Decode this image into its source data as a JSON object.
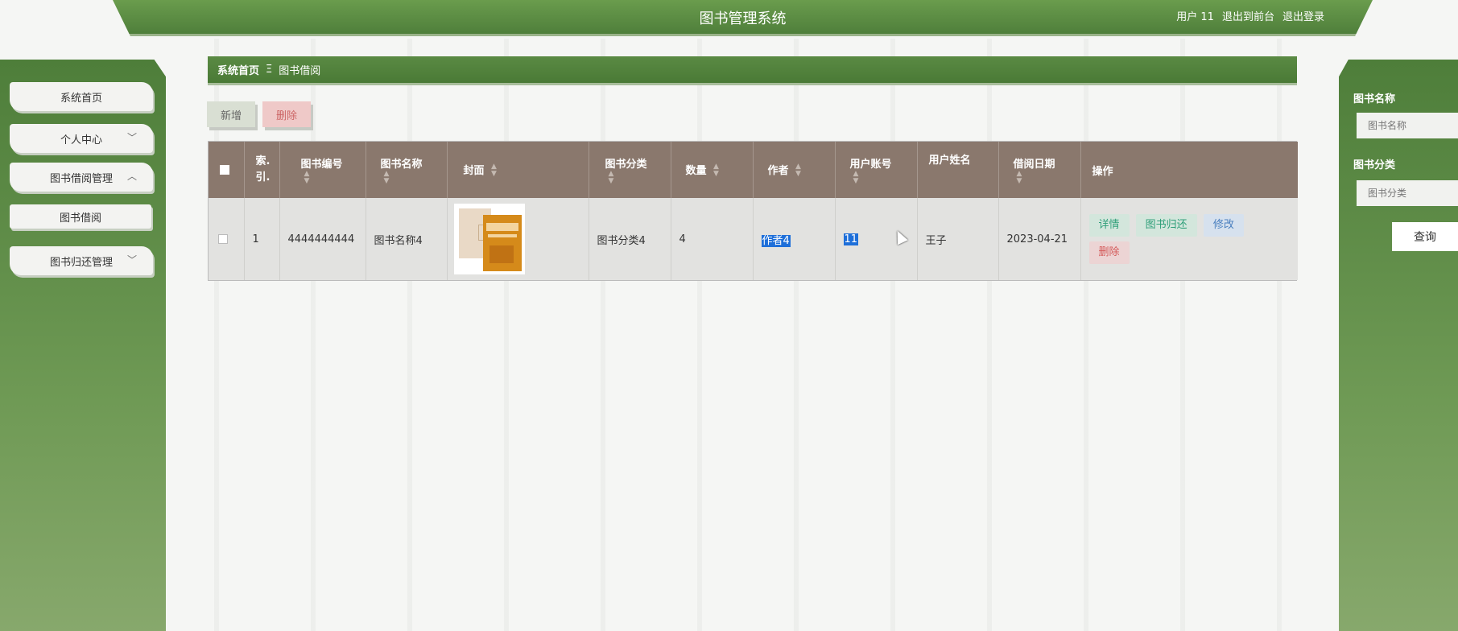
{
  "header": {
    "title": "图书管理系统",
    "user_label": "用户 11",
    "to_front": "退出到前台",
    "logout": "退出登录"
  },
  "sidebar": {
    "items": [
      {
        "label": "系统首页"
      },
      {
        "label": "个人中心"
      },
      {
        "label": "图书借阅管理"
      },
      {
        "label": "图书借阅"
      },
      {
        "label": "图书归还管理"
      }
    ]
  },
  "breadcrumb": {
    "home": "系统首页",
    "sep": "Ξ",
    "current": "图书借阅"
  },
  "actions": {
    "add": "新增",
    "delete": "删除"
  },
  "table": {
    "headers": {
      "index_1": "索.",
      "index_2": "引.",
      "book_no": "图书编号",
      "book_name": "图书名称",
      "cover": "封面",
      "category": "图书分类",
      "quantity": "数量",
      "author": "作者",
      "user_account": "用户账号",
      "user_name": "用户姓名",
      "borrow_date": "借阅日期",
      "ops": "操作"
    },
    "rows": [
      {
        "index": "1",
        "book_no": "4444444444",
        "book_name": "图书名称4",
        "category": "图书分类4",
        "quantity": "4",
        "author": "作者4",
        "user_account": "11",
        "user_name": "王子",
        "borrow_date": "2023-04-21"
      }
    ],
    "ops": {
      "detail": "详情",
      "return": "图书归还",
      "edit": "修改",
      "delete": "删除"
    }
  },
  "search": {
    "name_label": "图书名称",
    "name_placeholder": "图书名称",
    "category_label": "图书分类",
    "category_placeholder": "图书分类",
    "query": "查询"
  },
  "colors": {
    "primary_green": "#5a8a43",
    "table_header": "#8a786d",
    "selection": "#1e6fd9"
  }
}
